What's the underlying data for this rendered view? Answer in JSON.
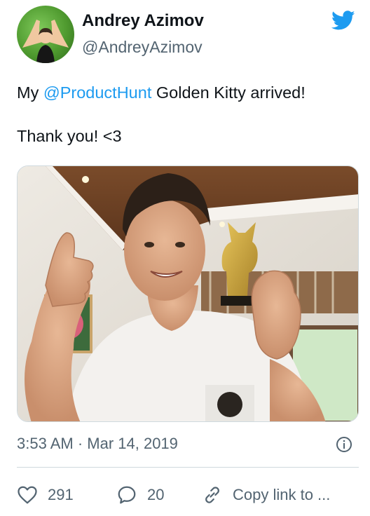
{
  "author": {
    "name": "Andrey Azimov",
    "handle": "@AndreyAzimov"
  },
  "tweet": {
    "prefix": "My ",
    "mention": "@ProductHunt",
    "suffix": " Golden Kitty arrived!",
    "line2": "Thank you! <3"
  },
  "timestamp": "3:53 AM · Mar 14, 2019",
  "actions": {
    "likes": "291",
    "replies": "20",
    "copy_label": "Copy link to ..."
  },
  "colors": {
    "accent": "#1d9bf0",
    "secondary_text": "#536471"
  }
}
